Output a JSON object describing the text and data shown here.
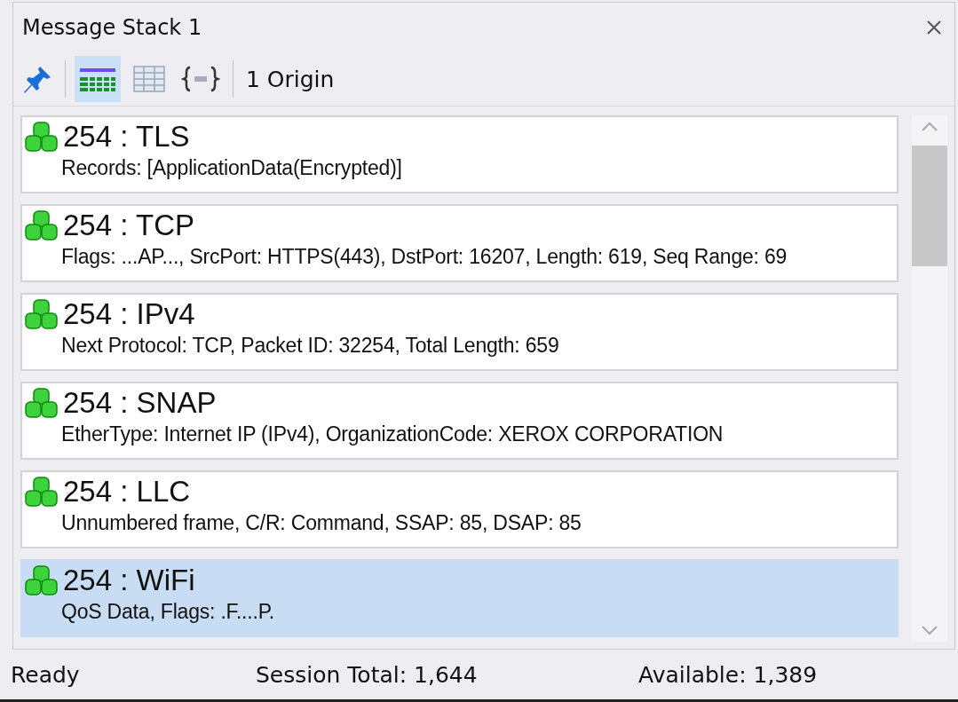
{
  "window": {
    "title": "Message Stack 1"
  },
  "toolbar": {
    "views": [
      {
        "kind": "list",
        "selected": true
      },
      {
        "kind": "grid",
        "selected": false
      },
      {
        "kind": "json",
        "selected": false
      }
    ],
    "origin": "1 Origin"
  },
  "messages": [
    {
      "title": "254 : TLS",
      "detail": "Records: [ApplicationData(Encrypted)]",
      "selected": false
    },
    {
      "title": "254 : TCP",
      "detail": "Flags: ...AP..., SrcPort: HTTPS(443), DstPort: 16207, Length: 619, Seq Range: 69",
      "selected": false
    },
    {
      "title": "254 : IPv4",
      "detail": "Next Protocol: TCP, Packet ID: 32254, Total Length: 659",
      "selected": false
    },
    {
      "title": "254 : SNAP",
      "detail": "EtherType: Internet IP (IPv4), OrganizationCode: XEROX CORPORATION",
      "selected": false
    },
    {
      "title": "254 : LLC",
      "detail": "Unnumbered frame, C/R: Command, SSAP: 85, DSAP: 85",
      "selected": false
    },
    {
      "title": "254 : WiFi",
      "detail": "QoS Data, Flags: .F....P.",
      "selected": true
    }
  ],
  "status_bar": {
    "state": "Ready",
    "session_total": "Session Total: 1,644",
    "available": "Available: 1,389"
  }
}
